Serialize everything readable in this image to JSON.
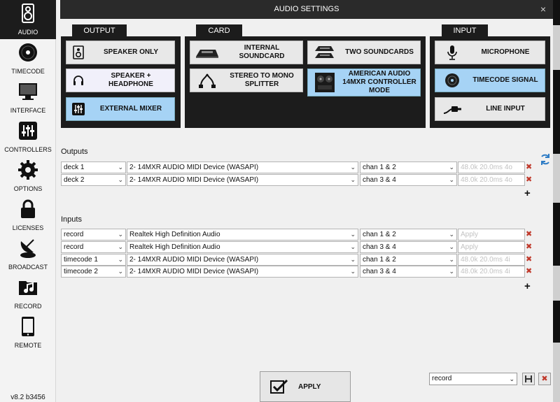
{
  "sidebar": {
    "items": [
      {
        "label": "AUDIO",
        "icon": "speaker-icon"
      },
      {
        "label": "TIMECODE",
        "icon": "vinyl-icon"
      },
      {
        "label": "INTERFACE",
        "icon": "monitor-icon"
      },
      {
        "label": "CONTROLLERS",
        "icon": "sliders-icon"
      },
      {
        "label": "OPTIONS",
        "icon": "gear-icon"
      },
      {
        "label": "LICENSES",
        "icon": "lock-icon"
      },
      {
        "label": "BROADCAST",
        "icon": "satellite-icon"
      },
      {
        "label": "RECORD",
        "icon": "music-folder-icon"
      },
      {
        "label": "REMOTE",
        "icon": "tablet-icon"
      }
    ],
    "version": "v8.2 b3456"
  },
  "dialog": {
    "title": "AUDIO SETTINGS",
    "close": "×"
  },
  "groups": {
    "output": {
      "label": "OUTPUT",
      "options": [
        {
          "label": "SPEAKER ONLY",
          "icon": "speaker-icon"
        },
        {
          "label": "SPEAKER + HEADPHONE",
          "icon": "headphone-icon"
        },
        {
          "label": "EXTERNAL MIXER",
          "icon": "mixer-icon"
        }
      ]
    },
    "card": {
      "label": "CARD",
      "options": [
        {
          "label": "INTERNAL SOUNDCARD",
          "icon": "soundcard-icon"
        },
        {
          "label": "STEREO TO MONO SPLITTER",
          "icon": "splitter-cable-icon"
        },
        {
          "label": "TWO SOUNDCARDS",
          "icon": "two-soundcards-icon"
        },
        {
          "label": "AMERICAN AUDIO 14MXR CONTROLLER MODE",
          "icon": "controller-icon"
        }
      ]
    },
    "input": {
      "label": "INPUT",
      "options": [
        {
          "label": "MICROPHONE",
          "icon": "microphone-icon"
        },
        {
          "label": "TIMECODE SIGNAL",
          "icon": "vinyl-icon"
        },
        {
          "label": "LINE INPUT",
          "icon": "jack-cable-icon"
        }
      ]
    }
  },
  "outputs": {
    "label": "Outputs",
    "rows": [
      {
        "name": "deck 1",
        "device": "2- 14MXR AUDIO MIDI Device (WASAPI)",
        "channels": "chan 1 & 2",
        "status": "48.0k 20.0ms 4o"
      },
      {
        "name": "deck 2",
        "device": "2- 14MXR AUDIO MIDI Device (WASAPI)",
        "channels": "chan 3 & 4",
        "status": "48.0k 20.0ms 4o"
      }
    ]
  },
  "inputs": {
    "label": "Inputs",
    "rows": [
      {
        "name": "record",
        "device": "Realtek High Definition Audio",
        "channels": "chan 1 & 2",
        "status": "Apply"
      },
      {
        "name": "record",
        "device": "Realtek High Definition Audio",
        "channels": "chan 3 & 4",
        "status": "Apply"
      },
      {
        "name": "timecode 1",
        "device": "2- 14MXR AUDIO MIDI Device (WASAPI)",
        "channels": "chan 1 & 2",
        "status": "48.0k 20.0ms 4i"
      },
      {
        "name": "timecode 2",
        "device": "2- 14MXR AUDIO MIDI Device (WASAPI)",
        "channels": "chan 3 & 4",
        "status": "48.0k 20.0ms 4i"
      }
    ]
  },
  "footer": {
    "apply_label": "APPLY",
    "preset_value": "record"
  },
  "colors": {
    "selected": "#a6d3f5",
    "panel": "#1c1c1c",
    "delete": "#c0392b"
  }
}
